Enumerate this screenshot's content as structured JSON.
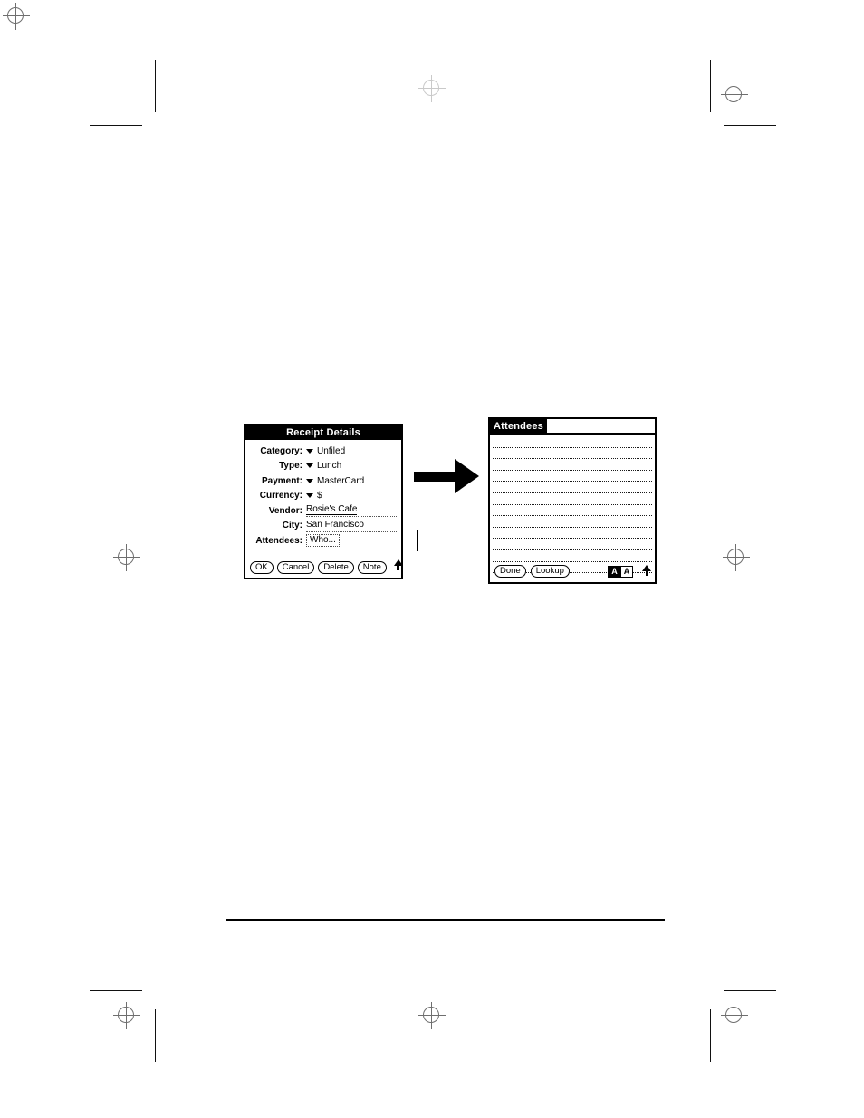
{
  "receipt_dialog": {
    "title": "Receipt Details",
    "fields": [
      {
        "label": "Category:",
        "value": "Unfiled",
        "kind": "picker"
      },
      {
        "label": "Type:",
        "value": "Lunch",
        "kind": "picker"
      },
      {
        "label": "Payment:",
        "value": "MasterCard",
        "kind": "picker"
      },
      {
        "label": "Currency:",
        "value": "$",
        "kind": "picker"
      },
      {
        "label": "Vendor:",
        "value": "Rosie's Cafe",
        "kind": "text"
      },
      {
        "label": "City:",
        "value": "San Francisco",
        "kind": "text"
      },
      {
        "label": "Attendees:",
        "value": "Who...",
        "kind": "box"
      }
    ],
    "buttons": [
      {
        "label": "OK"
      },
      {
        "label": "Cancel"
      },
      {
        "label": "Delete"
      },
      {
        "label": "Note"
      }
    ],
    "scroll_icon": "up-arrow-icon"
  },
  "attendees_screen": {
    "title": "Attendees",
    "title_field_value": "",
    "line_count": 12,
    "buttons": [
      {
        "label": "Done"
      },
      {
        "label": "Lookup"
      }
    ],
    "graffiti": {
      "shift_caps_label": "A",
      "shift_normal_label": "A"
    },
    "scroll_icon": "up-arrow-icon"
  },
  "flow": {
    "arrow_icon": "right-arrow-icon",
    "leader_icon": "callout-leader-line"
  },
  "print_marks": {
    "registration_icon": "registration-target-icon",
    "trim_icon": "trim-mark"
  },
  "colors": {
    "ink": "#000000",
    "paper": "#ffffff",
    "mark_gray": "#6e6e6e"
  }
}
